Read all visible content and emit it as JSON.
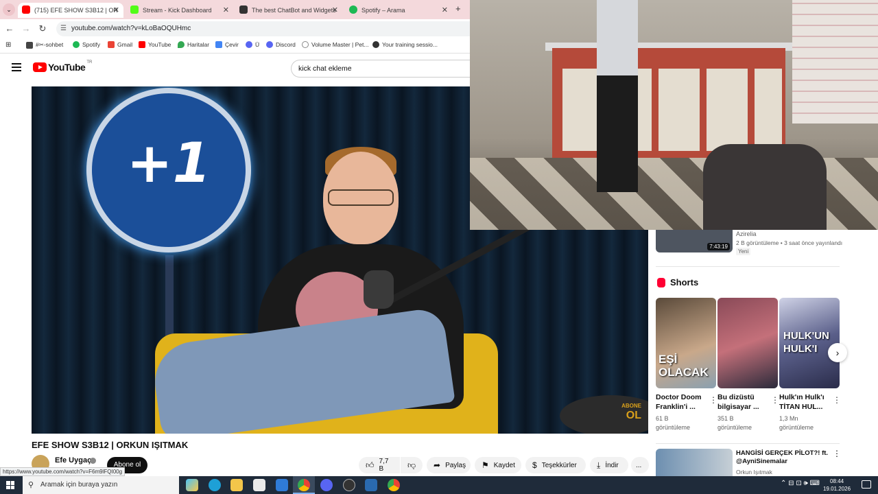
{
  "browser": {
    "tabs": [
      {
        "label": "(715) EFE SHOW S3B12 | OR",
        "favicon_color": "#ff0000",
        "active": true
      },
      {
        "label": "Stream - Kick Dashboard",
        "favicon_color": "#53fc18",
        "active": false
      },
      {
        "label": "The best ChatBot and Widgets",
        "favicon_color": "#333333",
        "active": false
      },
      {
        "label": "Spotify – Arama",
        "favicon_color": "#1db954",
        "active": false
      }
    ],
    "new_tab": "+",
    "url": "youtube.com/watch?v=kLoBaOQUHmc",
    "bookmarks": [
      {
        "label": "#✂-sohbet",
        "color": "#444"
      },
      {
        "label": "Spotify",
        "color": "#1db954"
      },
      {
        "label": "Gmail",
        "color": "#ea4335"
      },
      {
        "label": "YouTube",
        "color": "#ff0000"
      },
      {
        "label": "Haritalar",
        "color": "#34a853"
      },
      {
        "label": "Çevir",
        "color": "#4285f4"
      },
      {
        "label": "Ü",
        "color": "#5865f2"
      },
      {
        "label": "Discord",
        "color": "#5865f2"
      },
      {
        "label": "Volume Master | Pet...",
        "color": "#888"
      },
      {
        "label": "Your training sessio...",
        "color": "#333"
      }
    ]
  },
  "youtube": {
    "logo_text": "YouTube",
    "region": "TR",
    "search_value": "kick chat ekleme",
    "video": {
      "sign_text": "+1",
      "watermark_line1": "ABONE",
      "watermark_line2": "OL",
      "title": "EFE SHOW S3B12 | ORKUN IŞITMAK",
      "channel": "Efe Uygaç",
      "subscribe_label": "Abone ol",
      "actions": {
        "likes": "7,7 B",
        "share": "Paylaş",
        "save": "Kaydet",
        "thanks": "Teşekkürler",
        "download": "İndir",
        "more": "..."
      },
      "status_url": "https://www.youtube.com/watch?v=F6m9lFQI00g"
    },
    "sidebar": {
      "rec1": {
        "duration": "7:43:19",
        "channel": "Azirelia",
        "meta": "2 B görüntüleme • 3 saat önce yayınlandı",
        "badge": "Yeni"
      },
      "shorts_title": "Shorts",
      "shorts": [
        {
          "overlay": "EŞİ OLACAK",
          "title": "Doctor Doom Franklin'i ...",
          "views": "61 B görüntüleme",
          "bg": "#3c4a5a"
        },
        {
          "overlay": "",
          "title": "Bu dizüstü bilgisayar ...",
          "views": "351 B görüntüleme",
          "bg": "#7a3a48"
        },
        {
          "overlay": "HULK'UN HULK'I",
          "title": "Hulk'ın Hulk'ı TİTAN HUL...",
          "views": "1,3 Mn görüntüleme",
          "bg": "#5a5f8a"
        }
      ],
      "rec2": {
        "title": "HANGİSİ GERÇEK PİLOT?! ft. @AyniSinemalar",
        "channel": "Orkun Işıtmak"
      }
    }
  },
  "taskbar": {
    "search_placeholder": "Aramak için buraya yazın",
    "time": "08:44",
    "date": "19.01.2026"
  }
}
